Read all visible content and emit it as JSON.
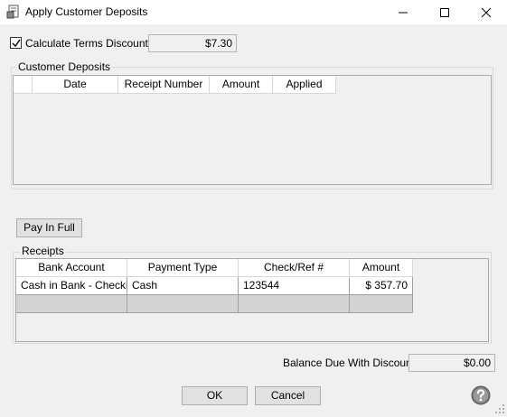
{
  "window": {
    "title": "Apply Customer Deposits",
    "icon": "app-document-icon"
  },
  "options": {
    "calc_terms_label": "Calculate Terms Discount",
    "calc_terms_checked": true,
    "terms_discount_value": "$7.30"
  },
  "deposits": {
    "group_label": "Customer Deposits",
    "columns": [
      "Date",
      "Receipt Number",
      "Amount",
      "Applied"
    ]
  },
  "pay_in_full_label": "Pay In Full",
  "receipts": {
    "group_label": "Receipts",
    "columns": [
      "Bank Account",
      "Payment Type",
      "Check/Ref #",
      "Amount"
    ],
    "rows": [
      [
        "Cash in Bank - Checki",
        "Cash",
        "123544",
        "$ 357.70"
      ]
    ]
  },
  "balance": {
    "label": "Balance Due With Discount",
    "value": "$0.00"
  },
  "buttons": {
    "ok": "OK",
    "cancel": "Cancel"
  }
}
